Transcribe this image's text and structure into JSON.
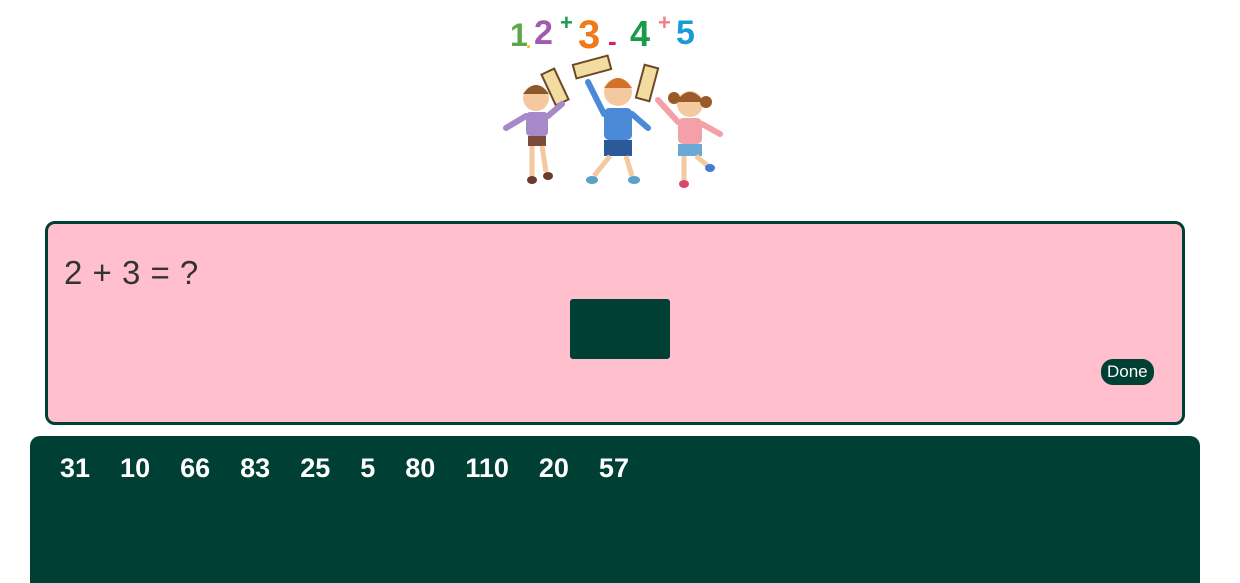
{
  "header": {
    "logo_text": "1.2+3-4+5",
    "colors": {
      "one": "#5aa84a",
      "two": "#a05ab0",
      "three": "#f07a1a",
      "four": "#1a9a4a",
      "five": "#1a9ad6"
    }
  },
  "question": {
    "text": "2 + 3 = ?",
    "done_label": "Done"
  },
  "tray": {
    "numbers": [
      "31",
      "10",
      "66",
      "83",
      "25",
      "5",
      "80",
      "110",
      "20",
      "57"
    ]
  },
  "theme": {
    "card_bg": "#ffbfcc",
    "accent": "#003f33",
    "text": "#333333"
  }
}
